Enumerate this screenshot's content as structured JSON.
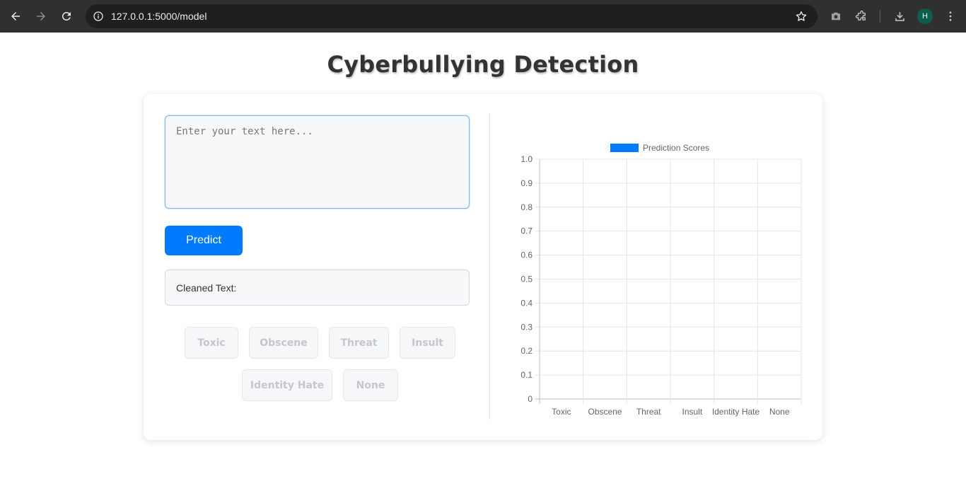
{
  "browser": {
    "url": "127.0.0.1:5000/model",
    "avatar_initial": "H"
  },
  "page": {
    "title": "Cyberbullying Detection"
  },
  "form": {
    "text_placeholder": "Enter your text here...",
    "predict_label": "Predict",
    "cleaned_text_label": "Cleaned Text:"
  },
  "labels": [
    "Toxic",
    "Obscene",
    "Threat",
    "Insult",
    "Identity Hate",
    "None"
  ],
  "colors": {
    "accent": "#007bff",
    "bar": "#007bff"
  },
  "chart_data": {
    "type": "bar",
    "categories": [
      "Toxic",
      "Obscene",
      "Threat",
      "Insult",
      "Identity Hate",
      "None"
    ],
    "series": [
      {
        "name": "Prediction Scores",
        "values": [
          0,
          0,
          0,
          0,
          0,
          0
        ]
      }
    ],
    "yticks": [
      "0",
      "0.1",
      "0.2",
      "0.3",
      "0.4",
      "0.5",
      "0.6",
      "0.7",
      "0.8",
      "0.9",
      "1.0"
    ],
    "ylim": [
      0,
      1
    ],
    "grid": true,
    "legend": "top-center"
  }
}
